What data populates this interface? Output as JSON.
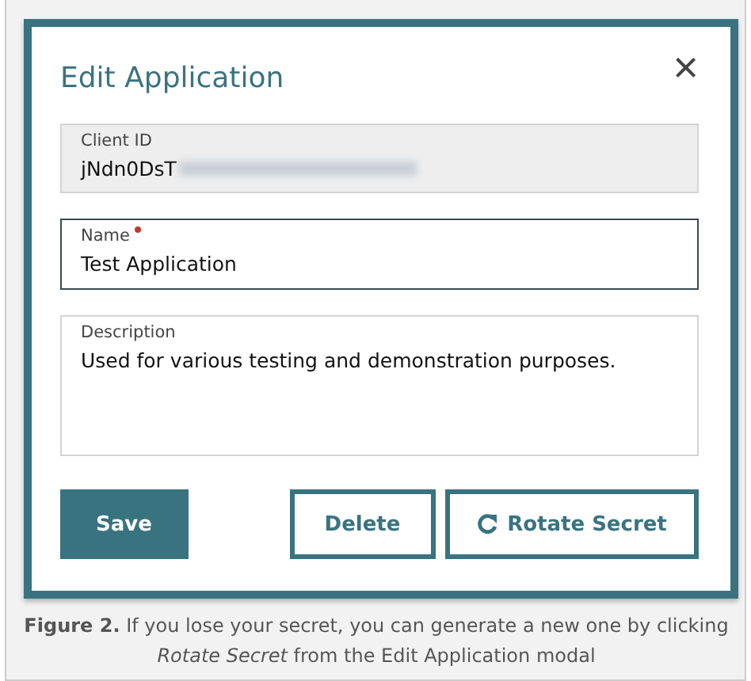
{
  "modal": {
    "title": "Edit Application",
    "close": "×",
    "fields": [
      {
        "kind": "readonly",
        "label": "Client ID",
        "value": "jNdn0DsT",
        "redacted": true,
        "required": false
      },
      {
        "kind": "text",
        "label": "Name",
        "value": "Test Application",
        "required": true,
        "focused": true
      },
      {
        "kind": "textarea",
        "label": "Description",
        "value": "Used for various testing and demonstration purposes.",
        "required": false,
        "focused": false
      }
    ],
    "buttons": [
      {
        "kind": "primary",
        "label": "Save"
      },
      {
        "kind": "outline",
        "label": "Delete"
      },
      {
        "kind": "outline-icon",
        "label": "Rotate Secret"
      }
    ]
  },
  "caption": "**Figure 2.** If you lose your secret, you can generate a new one by clicking *Rotate Secret* from the Edit Application modal"
}
